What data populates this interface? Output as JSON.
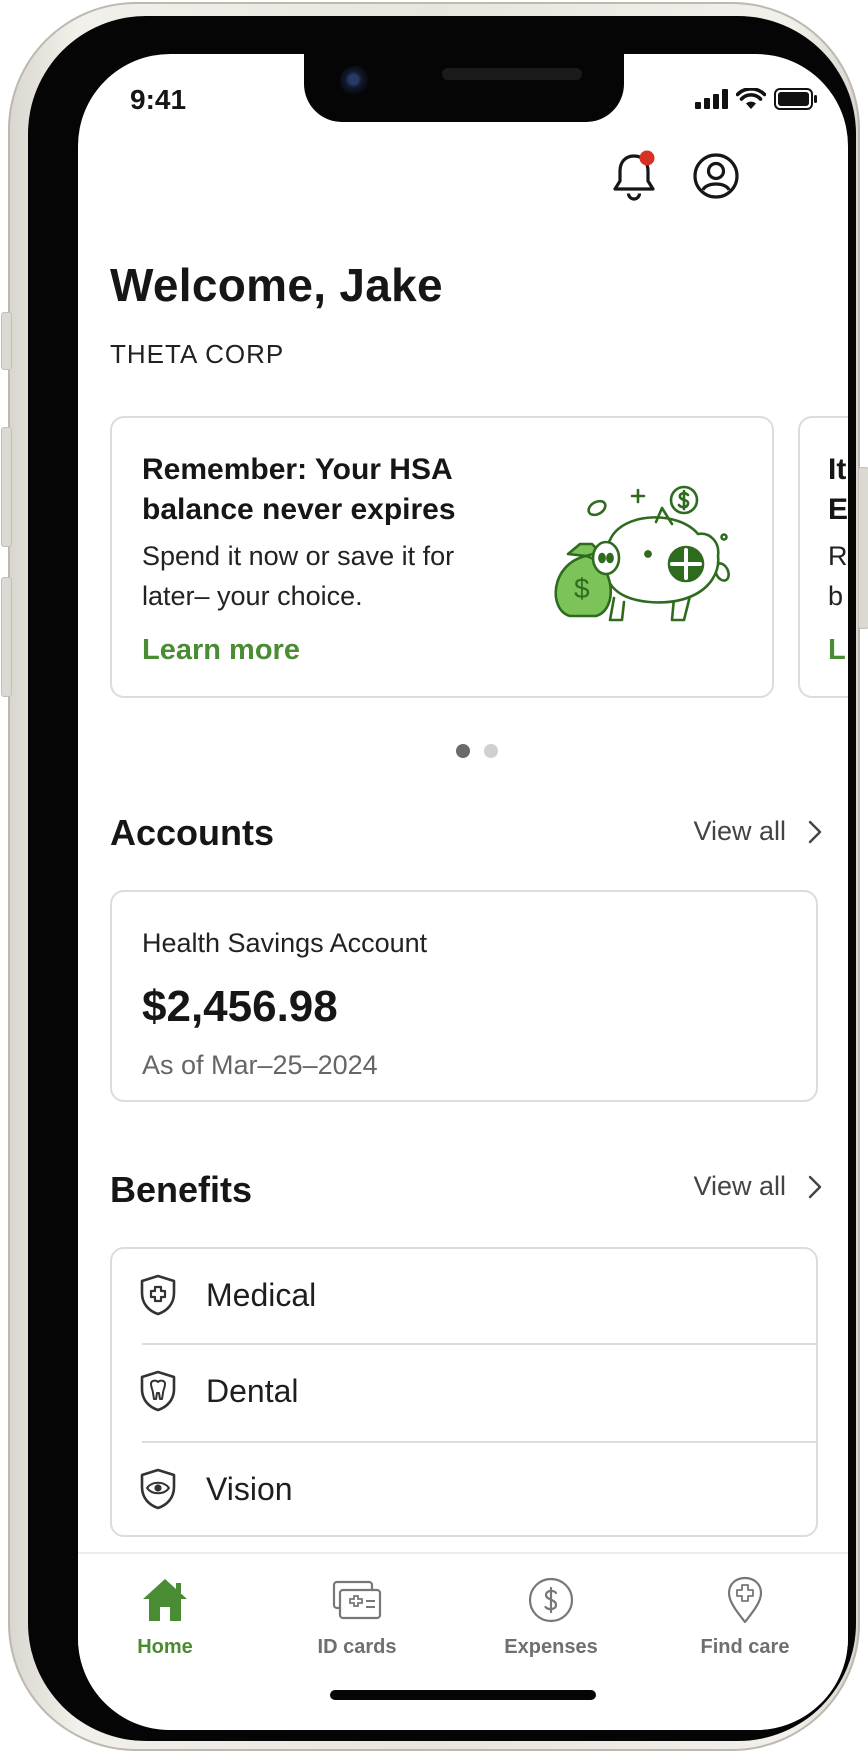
{
  "status_bar": {
    "time": "9:41"
  },
  "header": {
    "greeting": "Welcome, Jake",
    "company": "THETA CORP"
  },
  "promo_cards": [
    {
      "title": "Remember: Your HSA balance never expires",
      "body": "Spend it now or save it for later– your choice.",
      "link": "Learn more",
      "illustration": "piggy-bank-money-bag"
    },
    {
      "title_peek": "It\nE",
      "body_peek": "R\nb",
      "link_peek": "L"
    }
  ],
  "carousel": {
    "page_count": 2,
    "active_index": 0
  },
  "accounts": {
    "title": "Accounts",
    "view_all": "View all",
    "card": {
      "name": "Health Savings Account",
      "balance": "$2,456.98",
      "as_of": "As of Mar–25–2024"
    }
  },
  "benefits": {
    "title": "Benefits",
    "view_all": "View all",
    "items": [
      {
        "label": "Medical",
        "icon": "shield-cross-icon"
      },
      {
        "label": "Dental",
        "icon": "shield-tooth-icon"
      },
      {
        "label": "Vision",
        "icon": "shield-eye-icon"
      }
    ]
  },
  "tab_bar": {
    "items": [
      {
        "label": "Home",
        "icon": "home-icon",
        "active": true
      },
      {
        "label": "ID cards",
        "icon": "id-cards-icon",
        "active": false
      },
      {
        "label": "Expenses",
        "icon": "dollar-circle-icon",
        "active": false
      },
      {
        "label": "Find care",
        "icon": "location-pin-plus-icon",
        "active": false
      }
    ]
  },
  "colors": {
    "accent_green": "#4a8c34",
    "notification_dot": "#d93025",
    "text_primary": "#161616",
    "border": "#dcdcdc"
  }
}
